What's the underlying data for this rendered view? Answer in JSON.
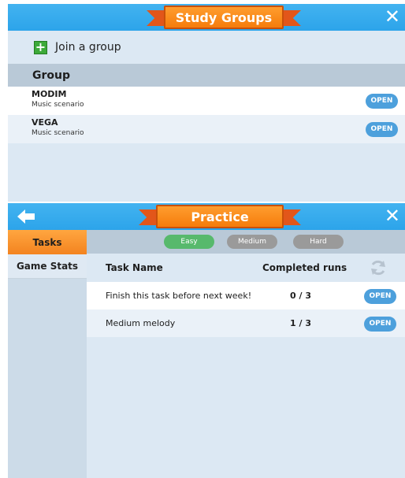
{
  "study_groups": {
    "title": "Study Groups",
    "close_icon": "close-icon",
    "join_label": "Join a group",
    "column_header": "Group",
    "groups": [
      {
        "name": "MODIM",
        "scenario": "Music scenario",
        "button": "OPEN"
      },
      {
        "name": "VEGA",
        "scenario": "Music scenario",
        "button": "OPEN"
      }
    ]
  },
  "practice": {
    "title": "Practice",
    "back_icon": "back-arrow-icon",
    "close_icon": "close-icon",
    "sidebar": [
      {
        "label": "Tasks",
        "active": true
      },
      {
        "label": "Game Stats",
        "active": false
      }
    ],
    "difficulty": {
      "easy": "Easy",
      "medium": "Medium",
      "hard": "Hard",
      "selected": "Easy"
    },
    "columns": {
      "name": "Task Name",
      "runs": "Completed runs"
    },
    "tasks": [
      {
        "name": "Finish this task before next week!",
        "runs": "0 / 3",
        "button": "OPEN"
      },
      {
        "name": "Medium melody",
        "runs": "1 / 3",
        "button": "OPEN"
      }
    ]
  },
  "colors": {
    "title_bar": "#2ca4ea",
    "ribbon": "#f57c0c",
    "open_button": "#4da0dc",
    "easy_selected": "#57b96c",
    "difficulty_unselected": "#9a9a9a",
    "active_tab": "#f3831f"
  }
}
